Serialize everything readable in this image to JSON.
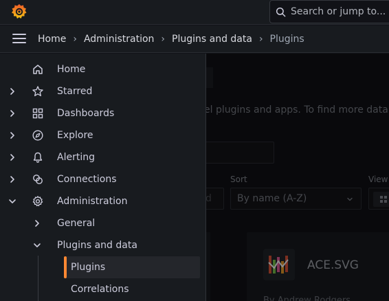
{
  "topbar": {
    "search_placeholder": "Search or jump to..."
  },
  "breadcrumb": {
    "items": [
      "Home",
      "Administration",
      "Plugins and data"
    ],
    "current": "Plugins"
  },
  "main": {
    "description_fragment": "el plugins and apps. To find more data",
    "sort_label": "Sort",
    "sort_value": "By name (A-Z)",
    "view_label": "View",
    "prev_select_fragment": "d",
    "card_name": "ACE.SVG",
    "card_author": "By Andrew Rodgers"
  },
  "sidebar": {
    "items": [
      {
        "label": "Home",
        "icon": "home-icon"
      },
      {
        "label": "Starred",
        "icon": "star-icon"
      },
      {
        "label": "Dashboards",
        "icon": "dashboards-icon"
      },
      {
        "label": "Explore",
        "icon": "compass-icon"
      },
      {
        "label": "Alerting",
        "icon": "bell-icon"
      },
      {
        "label": "Connections",
        "icon": "connections-icon"
      },
      {
        "label": "Administration",
        "icon": "gear-icon"
      }
    ],
    "admin_children": {
      "general": "General",
      "plugins_and_data": "Plugins and data"
    },
    "plugins_children": {
      "plugins": "Plugins",
      "correlations": "Correlations"
    }
  },
  "colors": {
    "accent": "#ff8833",
    "sidebar_bg": "#181b1f",
    "page_bg": "#111217"
  }
}
